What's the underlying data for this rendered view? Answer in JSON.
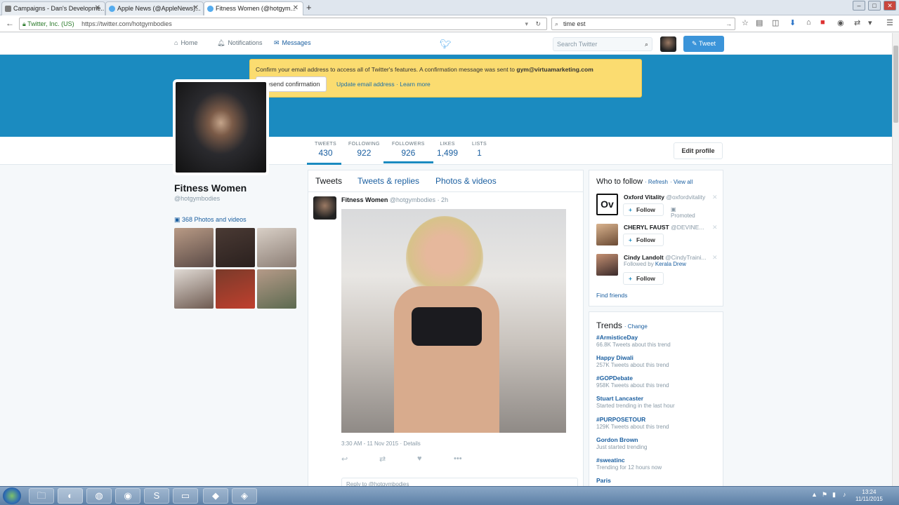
{
  "browser": {
    "tabs": [
      {
        "label": "Campaigns - Dan's Developme..."
      },
      {
        "label": "Apple News (@AppleNews)..."
      },
      {
        "label": "Fitness Women (@hotgym..."
      }
    ],
    "new_tab": "+",
    "site_identity": "Twitter, Inc. (US)",
    "url": "https://twitter.com/hotgymbodies",
    "search_value": "time est",
    "window_controls": [
      "–",
      "□",
      "✕"
    ]
  },
  "twitter_nav": {
    "home": "Home",
    "notifications": "Notifications",
    "messages": "Messages",
    "search_placeholder": "Search Twitter",
    "tweet_button": "Tweet"
  },
  "alert": {
    "message": "Confirm your email address to access all of Twitter's features. A confirmation message was sent to",
    "email": "gym@virtuamarketing.com",
    "resend": "Resend confirmation",
    "update": "Update email address",
    "separator": "·",
    "learn_more": "Learn more"
  },
  "stats": [
    {
      "label": "TWEETS",
      "value": "430"
    },
    {
      "label": "FOLLOWING",
      "value": "922"
    },
    {
      "label": "FOLLOWERS",
      "value": "926"
    },
    {
      "label": "LIKES",
      "value": "1,499"
    },
    {
      "label": "LISTS",
      "value": "1"
    }
  ],
  "edit_profile": "Edit profile",
  "profile": {
    "name": "Fitness Women",
    "handle": "@hotgymbodies",
    "photos_link": "368 Photos and videos"
  },
  "timeline": {
    "tabs": [
      "Tweets",
      "Tweets & replies",
      "Photos & videos"
    ],
    "tweet": {
      "name": "Fitness Women",
      "handle": "@hotgymbodies",
      "time": "· 2h",
      "meta": "3:30 AM - 11 Nov 2015 · Details"
    },
    "reply_placeholder": "Reply to @hotgymbodies"
  },
  "who_to_follow": {
    "title": "Who to follow",
    "refresh": "· Refresh",
    "view_all": "· View all",
    "follow_label": "Follow",
    "users": [
      {
        "name": "Oxford Vitality",
        "handle": "@oxfordvitality",
        "promoted": "Promoted",
        "logo": "Ov"
      },
      {
        "name": "CHERYL FAUST",
        "handle": "@DEVINE..."
      },
      {
        "name": "Cindy Landolt",
        "handle": "@CindyTraini...",
        "followed_by": "Followed by",
        "followed_by_name": "Kerala Drew"
      }
    ],
    "find_friends": "Find friends"
  },
  "trends": {
    "title": "Trends",
    "change": "· Change",
    "items": [
      {
        "name": "#ArmisticeDay",
        "count": "66.8K Tweets about this trend"
      },
      {
        "name": "Happy Diwali",
        "count": "257K Tweets about this trend"
      },
      {
        "name": "#GOPDebate",
        "count": "958K Tweets about this trend"
      },
      {
        "name": "Stuart Lancaster",
        "count": "Started trending in the last hour"
      },
      {
        "name": "#PURPOSETOUR",
        "count": "129K Tweets about this trend"
      },
      {
        "name": "Gordon Brown",
        "count": "Just started trending"
      },
      {
        "name": "#sweatinc",
        "count": "Trending for 12 hours now"
      },
      {
        "name": "Paris",
        "count": ""
      }
    ]
  },
  "taskbar": {
    "time": "13:24",
    "date": "11/11/2015"
  },
  "colors": {
    "banner": "#1b8bc0",
    "alert": "#fbdc70",
    "link": "#1b5fa0",
    "tweet_button": "#3b94d9"
  }
}
